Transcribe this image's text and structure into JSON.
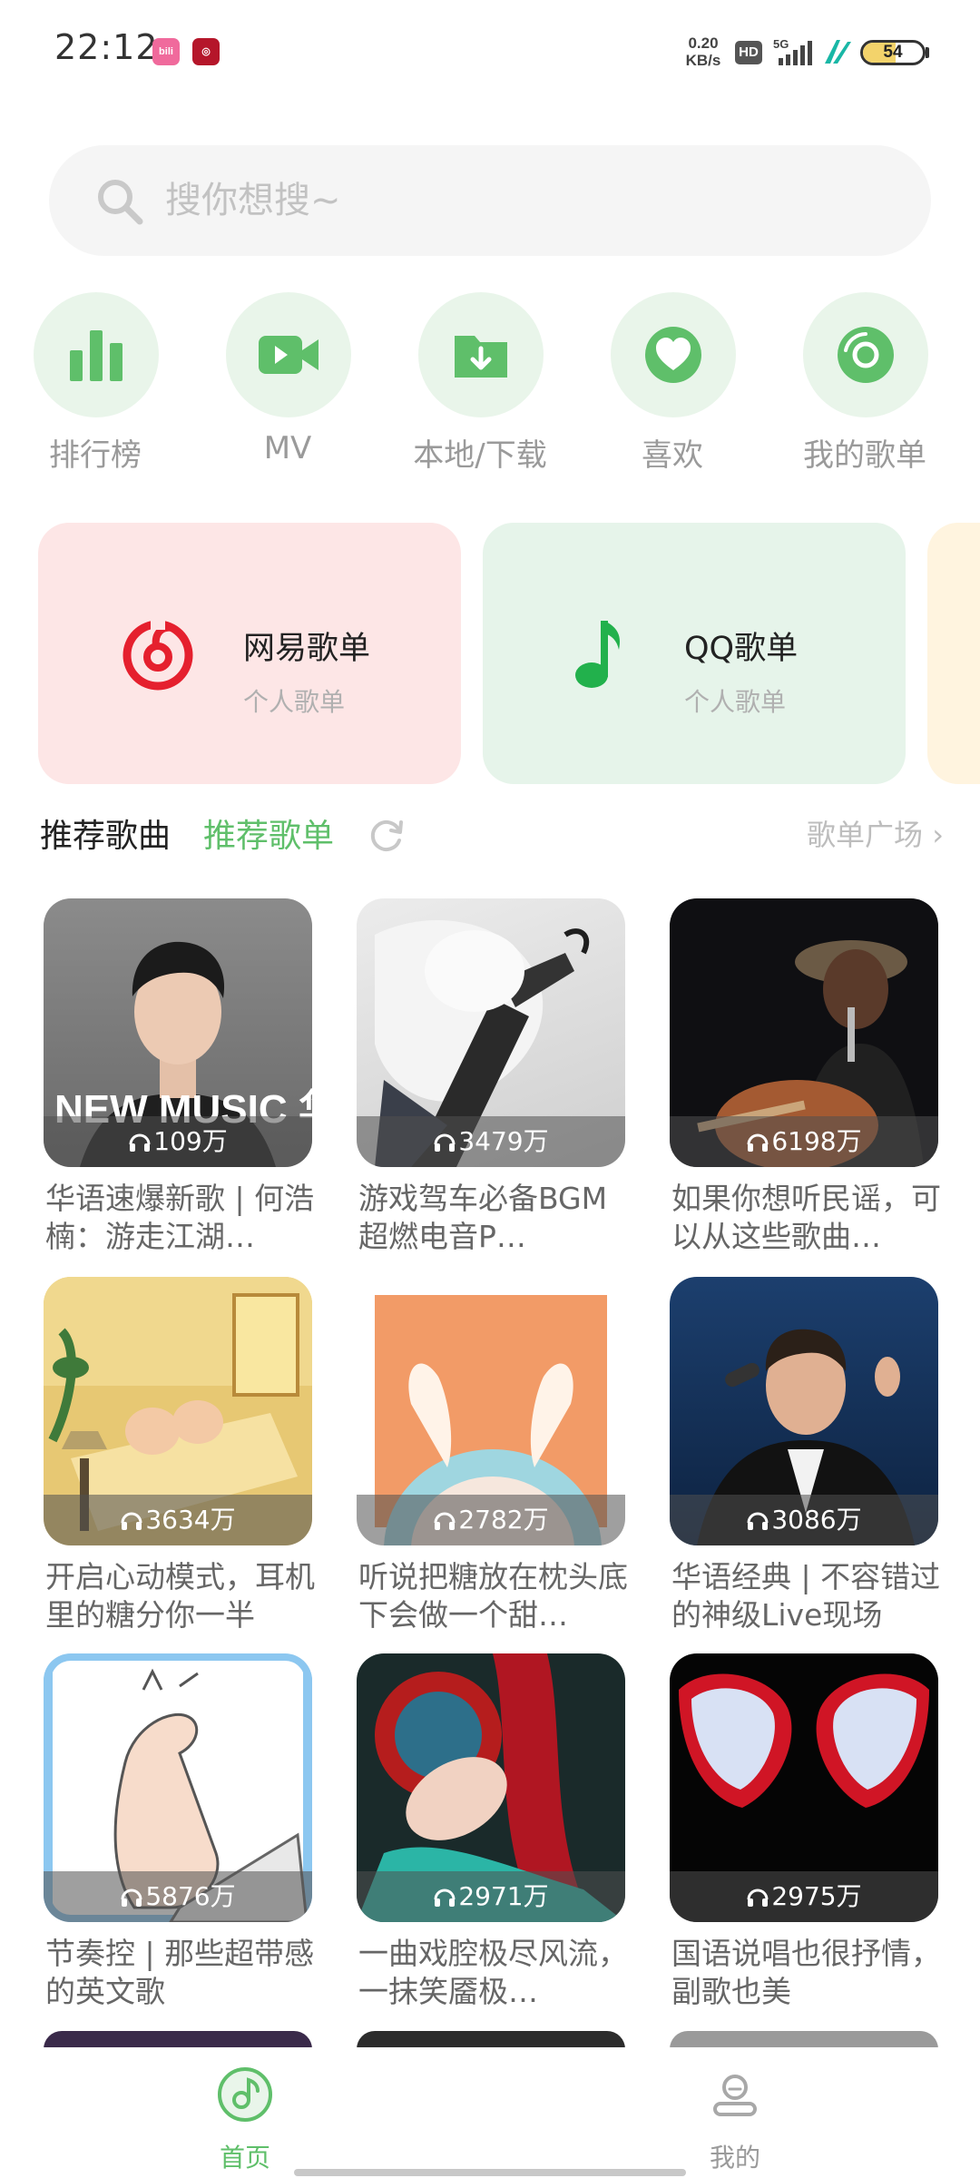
{
  "status_bar": {
    "time": "22:12",
    "net_speed_value": "0.20",
    "net_speed_unit": "KB/s",
    "hd_label": "HD",
    "network_type": "5G",
    "battery_level": "54",
    "battery_percent": 54,
    "app_badges": [
      "bilibili-icon",
      "app-red-icon"
    ]
  },
  "search": {
    "placeholder": "搜你想搜~"
  },
  "quick_entries": [
    {
      "label": "排行榜",
      "icon": "bar-chart-icon"
    },
    {
      "label": "MV",
      "icon": "video-camera-icon"
    },
    {
      "label": "本地/下载",
      "icon": "folder-download-icon"
    },
    {
      "label": "喜欢",
      "icon": "heart-icon"
    },
    {
      "label": "我的歌单",
      "icon": "vinyl-disc-icon"
    }
  ],
  "source_cards": [
    {
      "title": "网易歌单",
      "subtitle": "个人歌单",
      "icon": "netease-music-icon"
    },
    {
      "title": "QQ歌单",
      "subtitle": "个人歌单",
      "icon": "qq-music-note-icon"
    }
  ],
  "section": {
    "tab_songs": "推荐歌曲",
    "tab_playlists": "推荐歌单",
    "playlist_square": "歌单广场",
    "playlist_square_arrow": "›"
  },
  "playlists": [
    {
      "plays": "109万",
      "title": "华语速爆新歌 | 何浩楠：游走江湖…",
      "cover_text": "NEW MUSIC 华语"
    },
    {
      "plays": "3479万",
      "title": "游戏驾车必备BGM超燃电音P…"
    },
    {
      "plays": "6198万",
      "title": "如果你想听民谣，可以从这些歌曲…"
    },
    {
      "plays": "3634万",
      "title": "开启心动模式，耳机里的糖分你一半"
    },
    {
      "plays": "2782万",
      "title": "听说把糖放在枕头底下会做一个甜…"
    },
    {
      "plays": "3086万",
      "title": "华语经典 | 不容错过的神级Live现场"
    },
    {
      "plays": "5876万",
      "title": "节奏控 | 那些超带感的英文歌"
    },
    {
      "plays": "2971万",
      "title": "一曲戏腔极尽风流，一抹笑靥极…"
    },
    {
      "plays": "2975万",
      "title": "国语说唱也很抒情，副歌也美"
    }
  ],
  "bottom_nav": [
    {
      "label": "首页",
      "icon": "music-disc-icon",
      "active": true
    },
    {
      "label": "我的",
      "icon": "profile-icon",
      "active": false
    }
  ],
  "colors": {
    "accent_green": "#5fbf6a",
    "light_green_bg": "#e9f5ea",
    "netease_red": "#e5202e",
    "qq_green": "#22b14c"
  }
}
